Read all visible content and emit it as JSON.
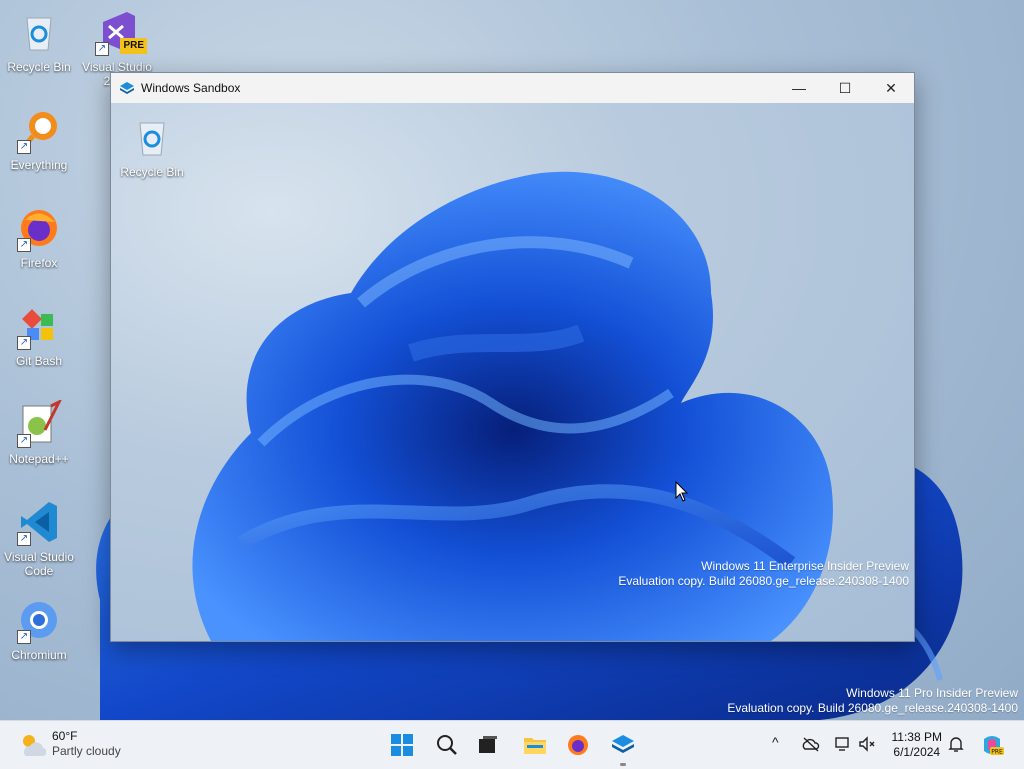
{
  "host_desktop": {
    "icons": [
      {
        "label": "Recycle Bin",
        "icon": "recycle-bin-icon"
      },
      {
        "label": "Visual Studio 2022",
        "icon": "visual-studio-icon",
        "badge": "PRE"
      },
      {
        "label": "Everything",
        "icon": "everything-search-icon"
      },
      {
        "label": "Firefox",
        "icon": "firefox-icon"
      },
      {
        "label": "Git Bash",
        "icon": "git-bash-icon"
      },
      {
        "label": "Notepad++",
        "icon": "notepad-plus-plus-icon"
      },
      {
        "label": "Visual Studio Code",
        "icon": "vscode-icon"
      },
      {
        "label": "Chromium",
        "icon": "chromium-icon"
      }
    ],
    "watermark": {
      "line1": "Windows 11 Pro Insider Preview",
      "line2": "Evaluation copy. Build 26080.ge_release.240308-1400"
    }
  },
  "sandbox_window": {
    "title": "Windows Sandbox",
    "controls": {
      "minimize": "—",
      "maximize": "☐",
      "close": "✕"
    },
    "desktop": {
      "icons": [
        {
          "label": "Recycle Bin",
          "icon": "recycle-bin-icon"
        }
      ],
      "watermark": {
        "line1": "Windows 11 Enterprise Insider Preview",
        "line2": "Evaluation copy. Build 26080.ge_release.240308-1400"
      }
    }
  },
  "taskbar": {
    "weather": {
      "temp": "60°F",
      "condition": "Partly cloudy"
    },
    "pinned": [
      "start-icon",
      "search-icon",
      "task-view-icon",
      "file-explorer-icon",
      "firefox-icon",
      "windows-sandbox-icon"
    ],
    "tray": {
      "chevron": "^"
    },
    "clock": {
      "time": "11:38 PM",
      "date": "6/1/2024"
    }
  },
  "colors": {
    "accent": "#1a5fd6",
    "bloom_dark": "#0b2f9e",
    "bloom_light": "#3d86ff"
  }
}
